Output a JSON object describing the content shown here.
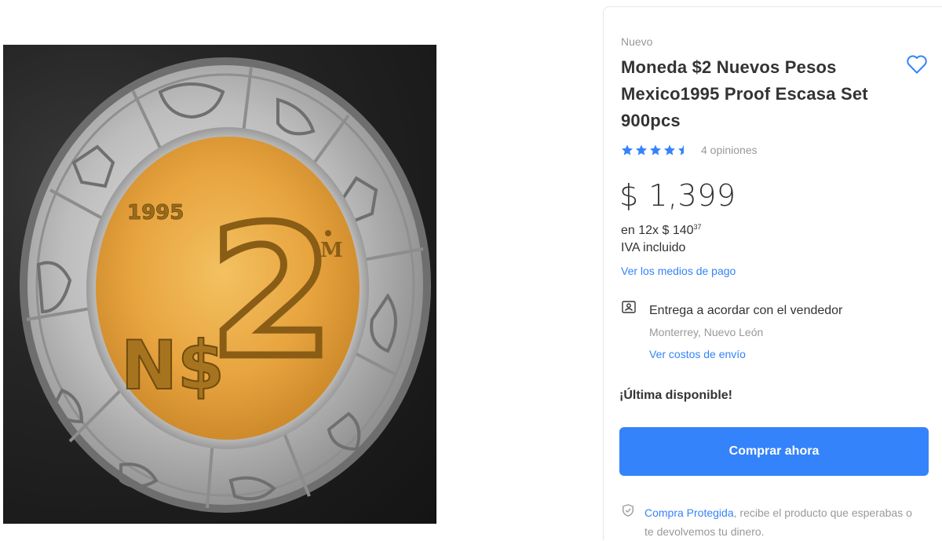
{
  "product_image": {
    "alt": "Moneda $2 Nuevos Pesos 1995",
    "coin": {
      "year": "1995",
      "denomination": "2",
      "currency_symbol": "N$",
      "mint_mark": "M"
    }
  },
  "buy_box": {
    "condition": "Nuevo",
    "title": "Moneda $2 Nuevos Pesos Mexico1995 Proof Escasa Set 900pcs",
    "rating": {
      "stars": 4.5,
      "reviews_label": "4 opiniones"
    },
    "price": "$ 1,399",
    "installments": {
      "prefix": "en 12x $ 140",
      "cents": "37"
    },
    "tax_note": "IVA incluido",
    "payment_link": "Ver los medios de pago",
    "shipping": {
      "icon": "delivery-person-icon",
      "title": "Entrega a acordar con el vendedor",
      "location": "Monterrey, Nuevo León",
      "link": "Ver costos de envío"
    },
    "stock": "¡Última disponible!",
    "buy_button": "Comprar ahora",
    "protection": {
      "icon": "shield-check-icon",
      "link": "Compra Protegida",
      "text": ", recibe el producto que esperabas o te devolvemos tu dinero."
    }
  },
  "colors": {
    "accent": "#3483fa",
    "text": "#333333",
    "muted": "#999999",
    "coin_center": "#e6a43c",
    "coin_ring": "#b9b9b9"
  }
}
